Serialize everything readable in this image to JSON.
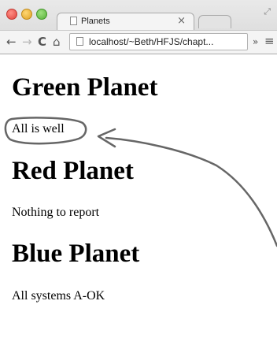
{
  "window": {
    "tab_title": "Planets",
    "tab_close": "×",
    "url": "localhost/~Beth/HFJS/chapt...",
    "overflow_label": "»",
    "menu_label": "≡",
    "back_label": "←",
    "forward_label": "→",
    "reload_label": "C",
    "home_label": "⌂"
  },
  "page": {
    "planets": [
      {
        "heading": "Green Planet",
        "status": "All is well"
      },
      {
        "heading": "Red Planet",
        "status": "Nothing to report"
      },
      {
        "heading": "Blue Planet",
        "status": "All systems A-OK"
      }
    ]
  },
  "annotation": {
    "color": "#666666",
    "icon": "hand-drawn-arrow-and-circle"
  }
}
